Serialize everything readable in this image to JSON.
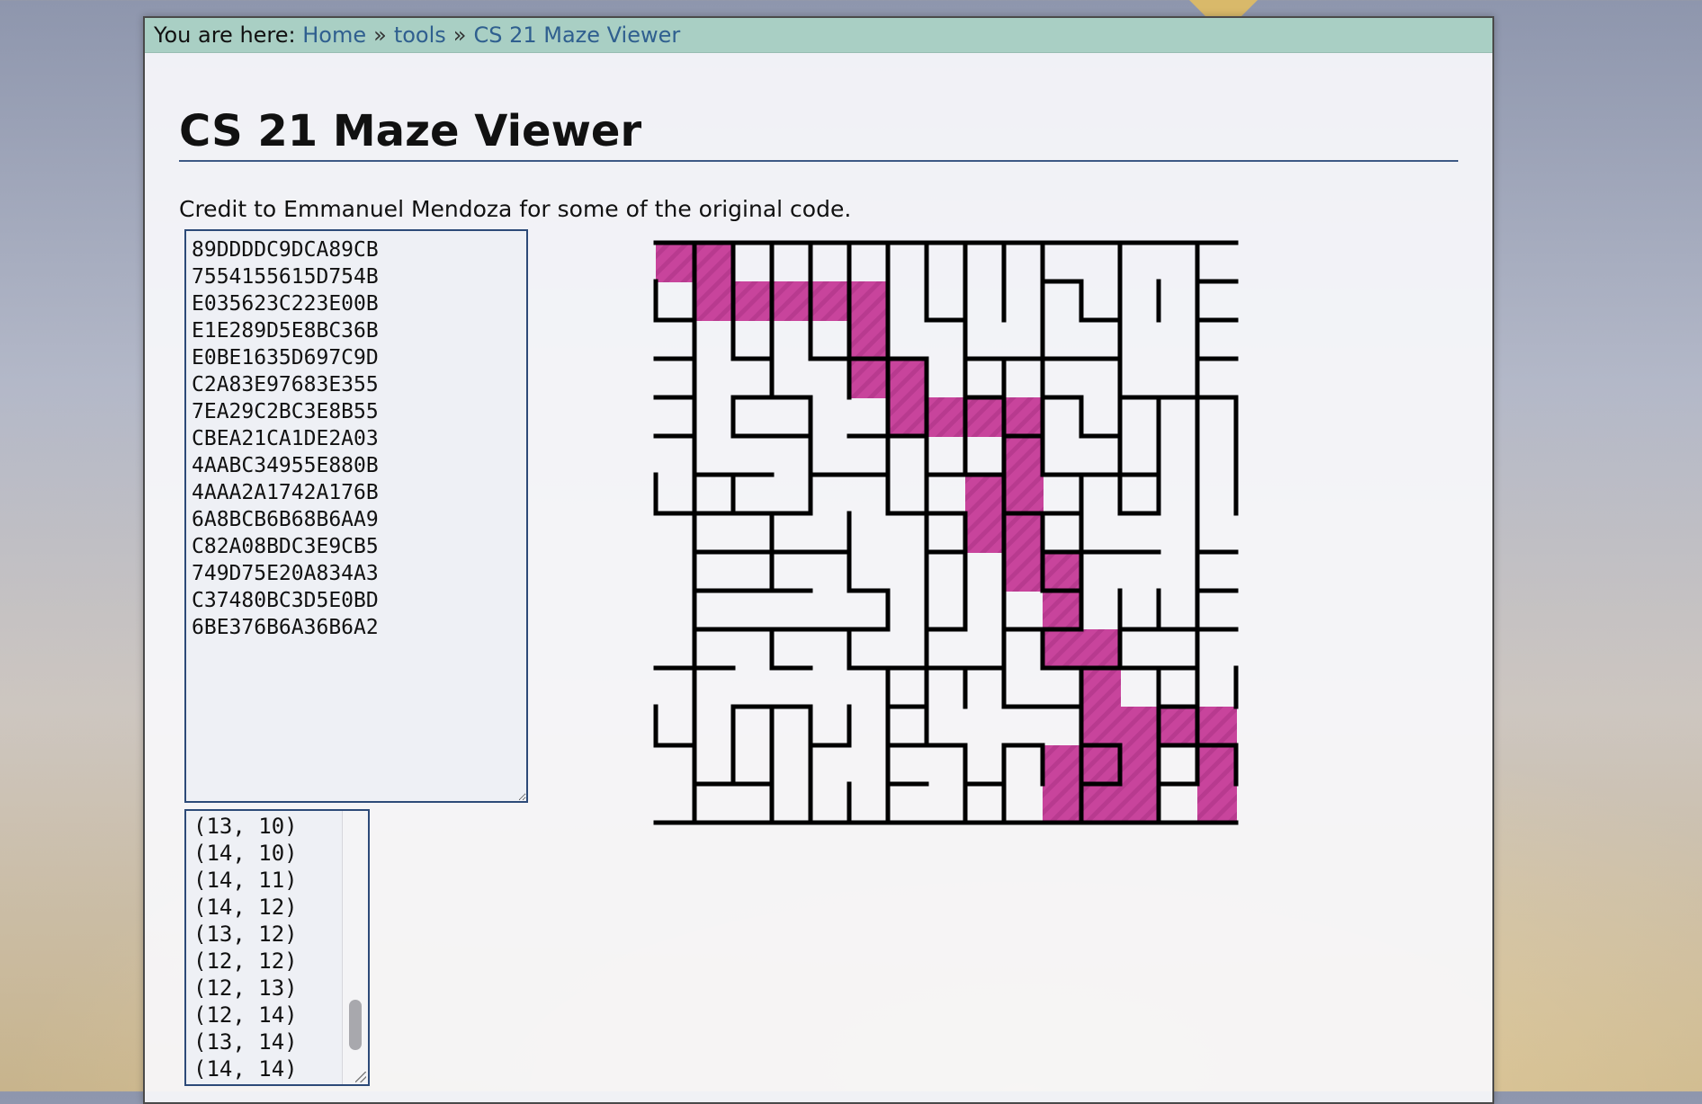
{
  "breadcrumb": {
    "prefix": "You are here:",
    "items": [
      "Home",
      "tools",
      "CS 21 Maze Viewer"
    ],
    "separator": "»"
  },
  "page": {
    "title": "CS 21 Maze Viewer",
    "credit": "Credit to Emmanuel Mendoza for some of the original code."
  },
  "maze_input": {
    "rows": [
      "89DDDDC9DCA89CB",
      "7554155615D754B",
      "E035623C223E00B",
      "E1E289D5E8BC36B",
      "E0BE1635D697C9D",
      "C2A83E97683E355",
      "7EA29C2BC3E8B55",
      "CBEA21CA1DE2A03",
      "4AABC34955E880B",
      "4AAA2A1742A176B",
      "6A8BCB6B68B6AA9",
      "C82A08BDC3E9CB5",
      "749D75E20A834A3",
      "C37480BC3D5E0BD",
      "6BE376B6A36B6A2"
    ]
  },
  "path_output": {
    "visible_lines": [
      "(13, 10)",
      "(14, 10)",
      "(14, 11)",
      "(14, 12)",
      "(13, 12)",
      "(12, 12)",
      "(12, 13)",
      "(12, 14)",
      "(13, 14)",
      "(14, 14)"
    ],
    "scroll_position": 0.85
  },
  "maze": {
    "rows": 15,
    "cols": 15,
    "wall_color": "#000000",
    "path_color": "#c8449c",
    "path": [
      [
        0,
        0
      ],
      [
        0,
        1
      ],
      [
        1,
        1
      ],
      [
        1,
        2
      ],
      [
        1,
        3
      ],
      [
        1,
        4
      ],
      [
        1,
        5
      ],
      [
        2,
        5
      ],
      [
        3,
        5
      ],
      [
        3,
        6
      ],
      [
        4,
        6
      ],
      [
        4,
        7
      ],
      [
        4,
        8
      ],
      [
        4,
        9
      ],
      [
        5,
        9
      ],
      [
        6,
        9
      ],
      [
        6,
        8
      ],
      [
        7,
        8
      ],
      [
        7,
        9
      ],
      [
        8,
        9
      ],
      [
        8,
        10
      ],
      [
        9,
        10
      ],
      [
        10,
        10
      ],
      [
        10,
        11
      ],
      [
        11,
        11
      ],
      [
        12,
        11
      ],
      [
        13,
        11
      ],
      [
        13,
        10
      ],
      [
        14,
        10
      ],
      [
        14,
        11
      ],
      [
        14,
        12
      ],
      [
        13,
        12
      ],
      [
        12,
        12
      ],
      [
        12,
        13
      ],
      [
        12,
        14
      ],
      [
        13,
        14
      ],
      [
        14,
        14
      ]
    ]
  }
}
